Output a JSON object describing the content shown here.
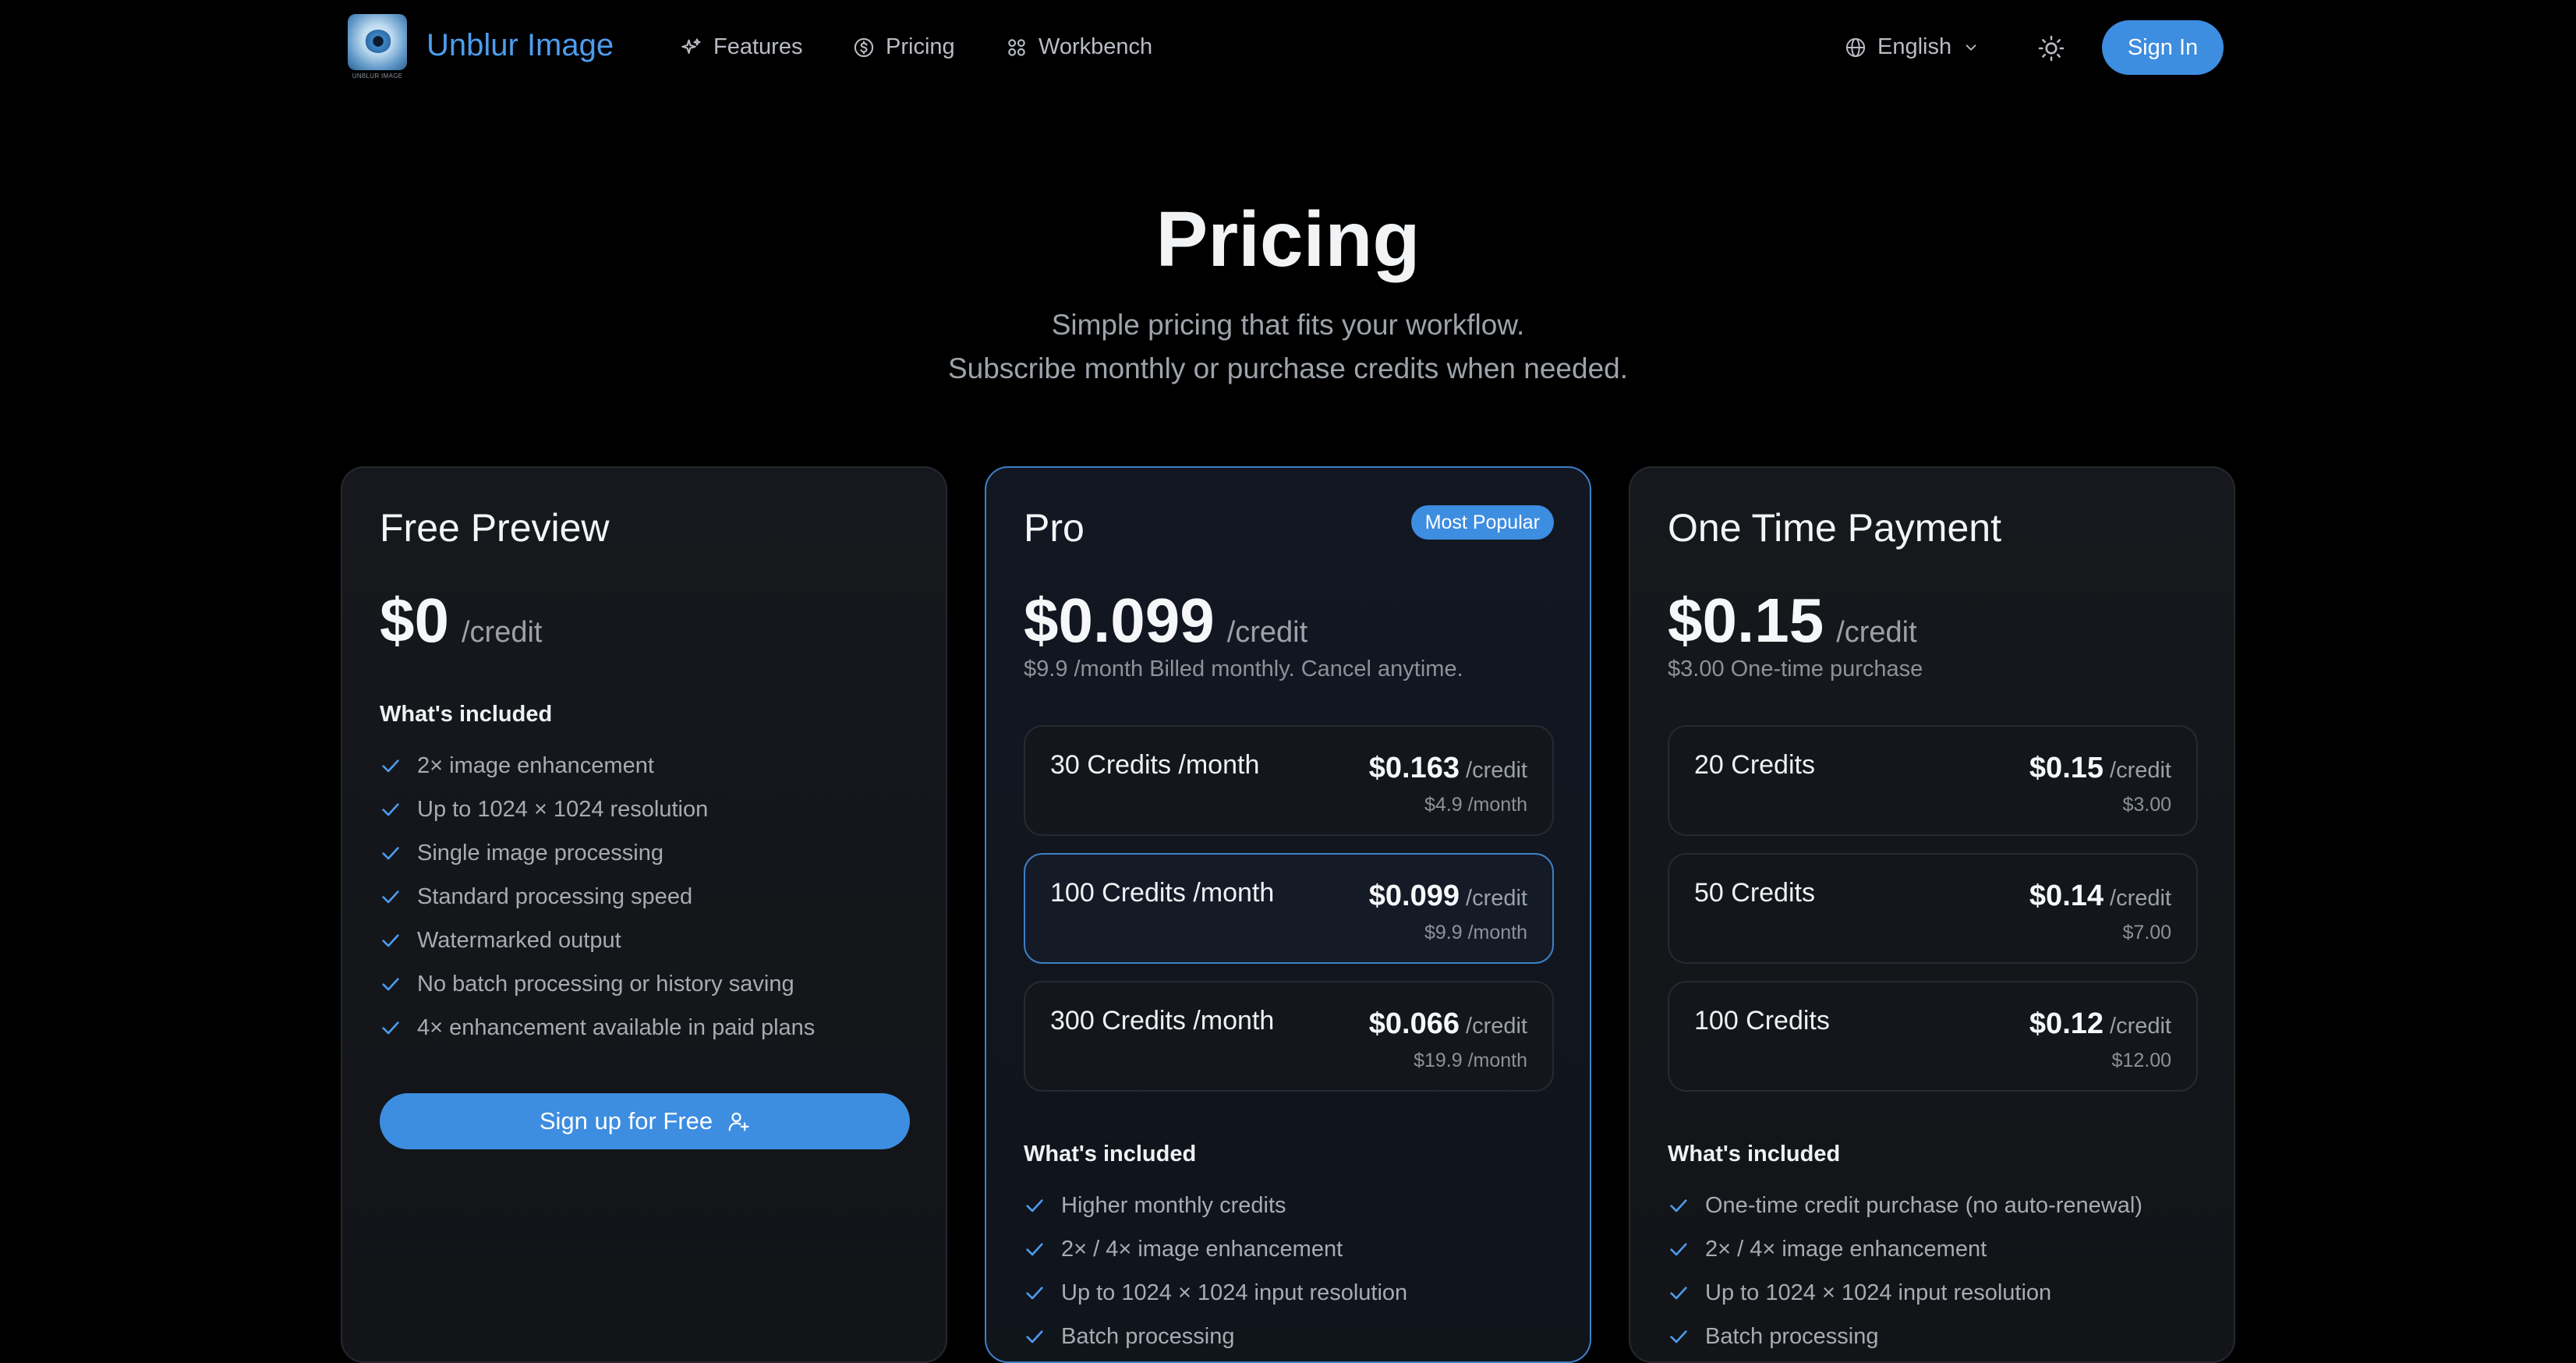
{
  "nav": {
    "brand": "Unblur Image",
    "logo_caption": "UNBLUR IMAGE",
    "links": [
      {
        "label": "Features",
        "icon": "sparkles-icon"
      },
      {
        "label": "Pricing",
        "icon": "dollar-circle-icon"
      },
      {
        "label": "Workbench",
        "icon": "grid-icon"
      }
    ],
    "language": "English",
    "sign_in": "Sign In",
    "accent": "#3d8de0"
  },
  "hero": {
    "title": "Pricing",
    "subtitle_1": "Simple pricing that fits your workflow.",
    "subtitle_2": "Subscribe monthly or purchase credits when needed."
  },
  "plans": [
    {
      "name": "Free Preview",
      "price": "$0",
      "unit": "/credit",
      "included_title": "What's included",
      "features": [
        "2× image enhancement",
        "Up to 1024 × 1024 resolution",
        "Single image processing",
        "Standard processing speed",
        "Watermarked output",
        "No batch processing or history saving",
        "4× enhancement available in paid plans"
      ],
      "cta": "Sign up for Free"
    },
    {
      "name": "Pro",
      "badge": "Most Popular",
      "price": "$0.099",
      "unit": "/credit",
      "billing": "$9.9 /month Billed monthly. Cancel anytime.",
      "options": [
        {
          "label": "30 Credits /month",
          "price": "$0.163",
          "unit": "/credit",
          "sub": "$4.9 /month",
          "selected": false
        },
        {
          "label": "100 Credits /month",
          "price": "$0.099",
          "unit": "/credit",
          "sub": "$9.9 /month",
          "selected": true
        },
        {
          "label": "300 Credits /month",
          "price": "$0.066",
          "unit": "/credit",
          "sub": "$19.9 /month",
          "selected": false
        }
      ],
      "included_title": "What's included",
      "features": [
        "Higher monthly credits",
        "2× / 4× image enhancement",
        "Up to 1024 × 1024 input resolution",
        "Batch processing"
      ]
    },
    {
      "name": "One Time Payment",
      "price": "$0.15",
      "unit": "/credit",
      "billing": "$3.00 One-time purchase",
      "options": [
        {
          "label": "20 Credits",
          "price": "$0.15",
          "unit": "/credit",
          "sub": "$3.00",
          "selected": false
        },
        {
          "label": "50 Credits",
          "price": "$0.14",
          "unit": "/credit",
          "sub": "$7.00",
          "selected": false
        },
        {
          "label": "100 Credits",
          "price": "$0.12",
          "unit": "/credit",
          "sub": "$12.00",
          "selected": false
        }
      ],
      "included_title": "What's included",
      "features": [
        "One-time credit purchase (no auto-renewal)",
        "2× / 4× image enhancement",
        "Up to 1024 × 1024 input resolution",
        "Batch processing"
      ]
    }
  ]
}
